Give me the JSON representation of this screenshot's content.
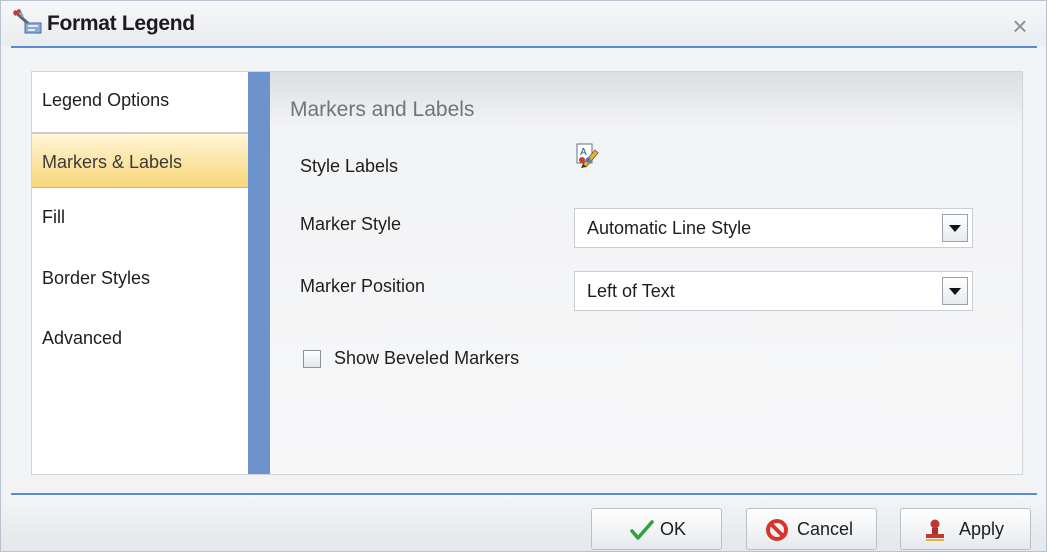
{
  "dialog": {
    "title": "Format Legend",
    "close_symbol": "×",
    "title_icon": "format-legend-icon"
  },
  "nav": {
    "items": [
      {
        "label": "Legend Options",
        "selected": false
      },
      {
        "label": "Markers & Labels",
        "selected": true
      },
      {
        "label": "Fill",
        "selected": false
      },
      {
        "label": "Border Styles",
        "selected": false
      },
      {
        "label": "Advanced",
        "selected": false
      }
    ]
  },
  "content": {
    "section_title": "Markers and Labels",
    "style_labels": {
      "label": "Style Labels",
      "icon": "style-labels-icon"
    },
    "marker_style": {
      "label": "Marker Style",
      "value": "Automatic Line Style"
    },
    "marker_position": {
      "label": "Marker Position",
      "value": "Left of Text"
    },
    "show_beveled_markers": {
      "label": "Show Beveled Markers",
      "checked": false
    }
  },
  "footer": {
    "ok_label": "OK",
    "cancel_label": "Cancel",
    "apply_label": "Apply"
  },
  "colors": {
    "accent_blue": "#5b8bd1",
    "nav_divider": "#6d93cd",
    "selected_item": "#f8d679",
    "ok_check": "#2ea33a",
    "cancel_red": "#d9342b"
  }
}
